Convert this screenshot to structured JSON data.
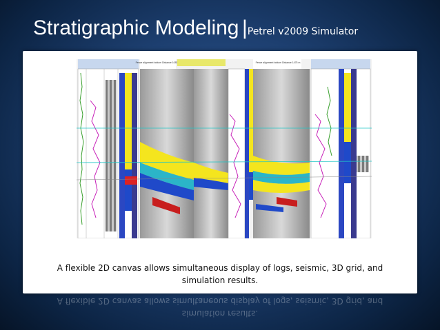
{
  "slide": {
    "title": "Stratigraphic Modeling",
    "separator": "|",
    "subtitle": "Petrel v2009 Simulator",
    "caption_line1": "A flexible 2D canvas allows simultaneous display of logs, seismic, 3D grid, and",
    "caption_line2": "simulation results."
  },
  "figure": {
    "header_labels": [
      "Fence alignment bottom Distance 1083 m",
      "Fence alignment bottom Distance 1475 m"
    ]
  },
  "colors": {
    "background": "#1d3f70",
    "seismic_yellow": "#f4e51e",
    "seismic_blue": "#1f49c9",
    "log_magenta": "#c71fb8",
    "log_green": "#3aa02e"
  }
}
